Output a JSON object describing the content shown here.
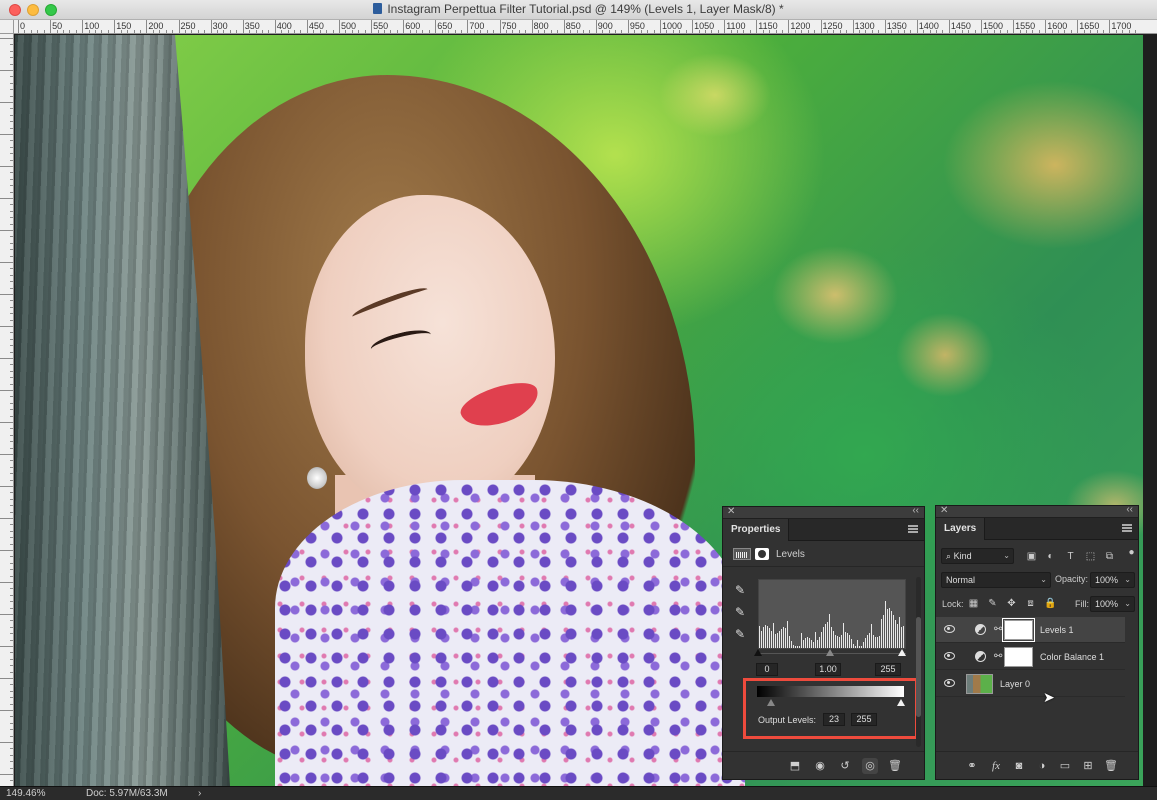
{
  "window": {
    "title": "Instagram Perpettua Filter Tutorial.psd @ 149% (Levels 1, Layer Mask/8) *"
  },
  "ruler": {
    "top_labels": [
      "0",
      "50",
      "100",
      "150",
      "200",
      "250",
      "300",
      "350",
      "400",
      "450",
      "500",
      "550",
      "600",
      "650",
      "700",
      "750",
      "800",
      "850",
      "900",
      "950",
      "1000",
      "1050",
      "1100",
      "1150",
      "1200",
      "1250",
      "1300",
      "1350",
      "1400",
      "1450",
      "1500",
      "1550",
      "1600",
      "1650",
      "1700"
    ]
  },
  "status": {
    "zoom": "149.46%",
    "doc": "Doc: 5.97M/63.3M",
    "arrow": "›"
  },
  "properties": {
    "tab": "Properties",
    "adjustment_name": "Levels",
    "input_black": "0",
    "input_gamma": "1.00",
    "input_white": "255",
    "output_label": "Output Levels:",
    "output_black": "23",
    "output_white": "255",
    "footer_icons": [
      "clip-to-layer-icon",
      "view-previous-icon",
      "reset-icon",
      "visibility-icon",
      "trash-icon"
    ]
  },
  "layers": {
    "tab": "Layers",
    "filter_kind": "Kind",
    "blend_mode": "Normal",
    "opacity_label": "Opacity:",
    "opacity_value": "100%",
    "lock_label": "Lock:",
    "fill_label": "Fill:",
    "fill_value": "100%",
    "items": [
      {
        "name": "Levels 1",
        "selected": true
      },
      {
        "name": "Color Balance 1",
        "selected": false
      },
      {
        "name": "Layer 0",
        "selected": false
      }
    ],
    "footer": {
      "link": "⚭",
      "fx": "fx"
    }
  }
}
